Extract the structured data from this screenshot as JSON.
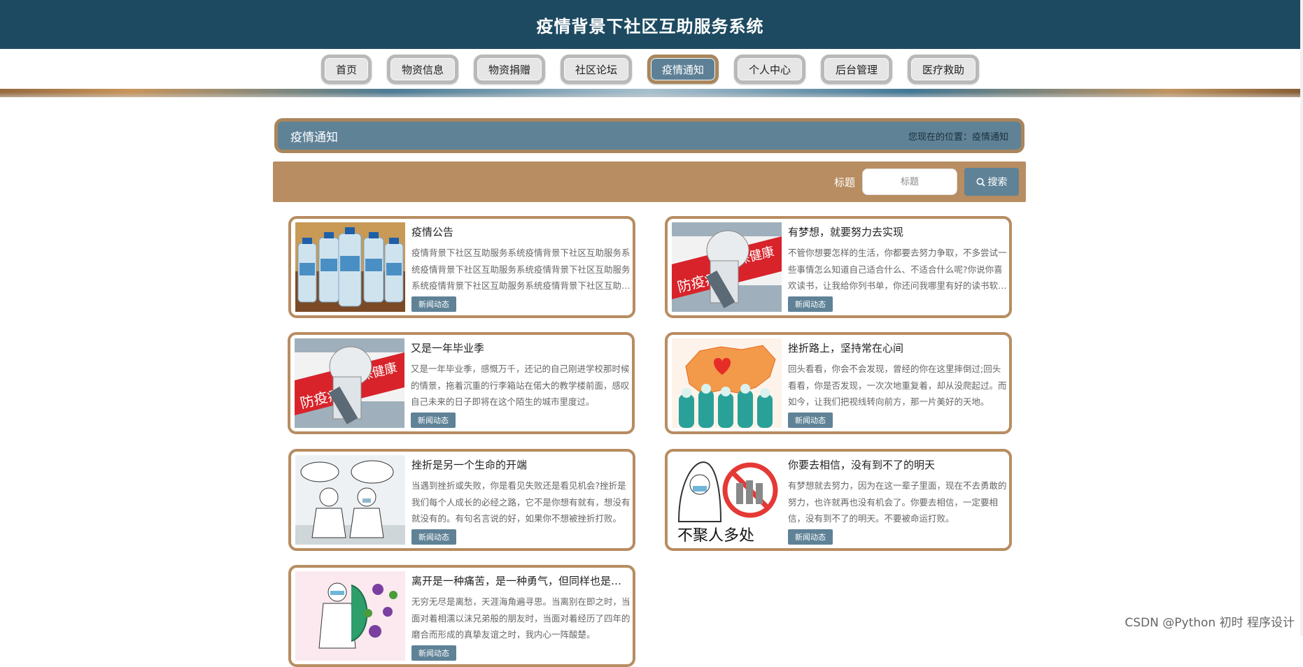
{
  "header": {
    "title": "疫情背景下社区互助服务系统"
  },
  "nav": {
    "items": [
      {
        "label": "首页",
        "active": false
      },
      {
        "label": "物资信息",
        "active": false
      },
      {
        "label": "物资捐赠",
        "active": false
      },
      {
        "label": "社区论坛",
        "active": false
      },
      {
        "label": "疫情通知",
        "active": true
      },
      {
        "label": "个人中心",
        "active": false
      },
      {
        "label": "后台管理",
        "active": false
      },
      {
        "label": "医疗救助",
        "active": false
      }
    ]
  },
  "titlebar": {
    "name": "疫情通知",
    "location": "您现在的位置：疫情通知"
  },
  "search": {
    "label": "标题",
    "placeholder": "标题",
    "button_label": "搜索"
  },
  "cards": [
    {
      "title": "疫情公告",
      "desc": "疫情背景下社区互助服务系统疫情背景下社区互助服务系统疫情背景下社区互助服务系统疫情背景下社区互助服务系统疫情背景下社区互助服务系统疫情背景下社区互助服务系统",
      "tag": "新闻动态",
      "image": "water-bottles-image"
    },
    {
      "title": "有梦想，就要努力去实现",
      "desc": "不管你想要怎样的生活，你都要去努力争取，不多尝试一些事情怎么知道自己适合什么、不适合什么呢?你说你喜欢读书，让我给你列书单，你还问我哪里有好的读书软件。",
      "tag": "新闻动态",
      "image": "epidemic-worker-image"
    },
    {
      "title": "又是一年毕业季",
      "desc": "又是一年毕业季，感慨万千，还记的自己刚进学校那时候的情景，拖着沉重的行李箱站在偌大的教学楼前面，感叹自己未来的日子即将在这个陌生的城市里度过。",
      "tag": "新闻动态",
      "image": "epidemic-worker-image"
    },
    {
      "title": "挫折路上，坚持常在心间",
      "desc": "回头看看，你会不会发现，曾经的你在这里摔倒过;回头看看，你是否发现，一次次地重复着，却从没爬起过。而如今，让我们把视线转向前方，那一片美好的天地。",
      "tag": "新闻动态",
      "image": "china-map-image"
    },
    {
      "title": "挫折是另一个生命的开端",
      "desc": "当遇到挫折或失败，你是看见失败还是看见机会?挫折是我们每个人成长的必经之路，它不是你想有就有，想没有就没有的。有句名言说的好，如果你不想被挫折打败。",
      "tag": "新闻动态",
      "image": "mask-cartoon-image"
    },
    {
      "title": "你要去相信，没有到不了的明天",
      "desc": "有梦想就去努力，因为在这一辈子里面，现在不去勇敢的努力，也许就再也没有机会了。你要去相信，一定要相信，没有到不了的明天。不要被命运打败。",
      "tag": "新闻动态",
      "image": "no-gathering-image"
    },
    {
      "title": "离开是一种痛苦，是一种勇气，但同样也是一个考验",
      "desc": "无穷无尽是离愁，天涯海角遍寻思。当离别在即之时，当面对着相濡以沫兄弟般的朋友时，当面对着经历了四年的磨合而形成的真挚友谊之时，我内心一阵酸楚。",
      "tag": "新闻动态",
      "image": "doctor-virus-image"
    }
  ],
  "watermark": "CSDN @Python 初时 程序设计"
}
